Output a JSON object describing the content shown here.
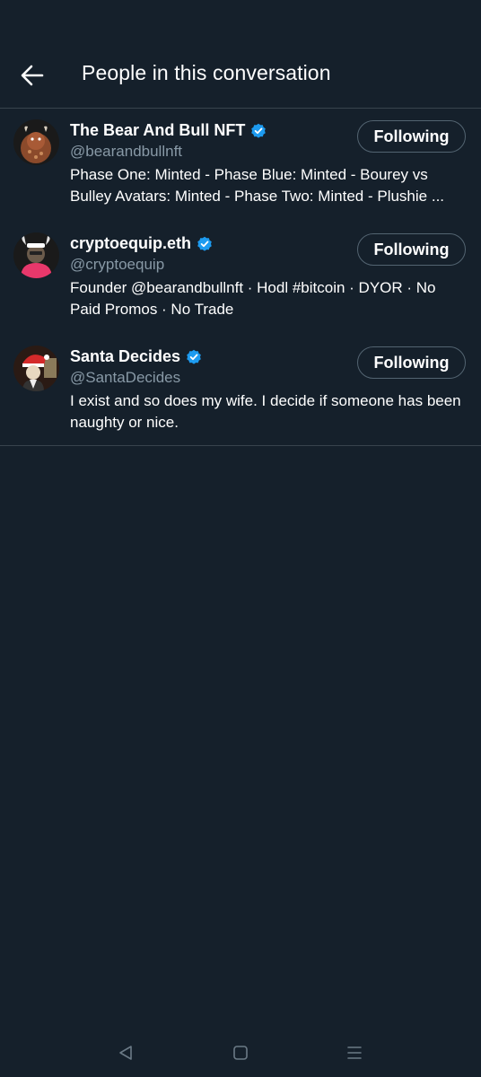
{
  "header": {
    "title": "People in this conversation",
    "back_icon": "arrow-left-icon"
  },
  "users": [
    {
      "name": "The Bear And Bull NFT",
      "handle": "@bearandbullnft",
      "verified": true,
      "bio": "Phase One: Minted - Phase Blue: Minted - Bourey vs Bulley Avatars: Minted - Phase Two: Minted - Plushie ...",
      "follow_label": "Following"
    },
    {
      "name": "cryptoequip.eth",
      "handle": "@cryptoequip",
      "verified": true,
      "bio": "Founder @bearandbullnft · Hodl #bitcoin · DYOR · No Paid Promos · No Trade",
      "follow_label": "Following"
    },
    {
      "name": "Santa Decides",
      "handle": "@SantaDecides",
      "verified": true,
      "bio": "I exist and so does my wife. I decide if someone has been naughty or nice.",
      "follow_label": "Following"
    }
  ],
  "system_nav": {
    "back_icon": "triangle-back-icon",
    "home_icon": "square-home-icon",
    "recents_icon": "lines-menu-icon"
  },
  "colors": {
    "background": "#15202b",
    "divider": "#38444d",
    "secondary_text": "#8899a6",
    "verified_badge": "#1d9bf0"
  }
}
